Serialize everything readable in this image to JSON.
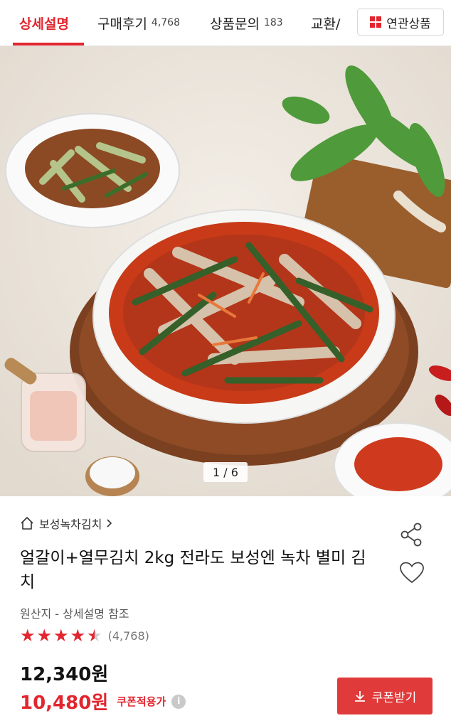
{
  "tabs": [
    {
      "label": "상세설명",
      "count": ""
    },
    {
      "label": "구매후기",
      "count": "4,768"
    },
    {
      "label": "상품문의",
      "count": "183"
    },
    {
      "label": "교환/",
      "count": ""
    }
  ],
  "related_label": "연관상품",
  "image_counter": "1 / 6",
  "store": "보성녹차김치",
  "product_title": "얼갈이+열무김치 2kg 전라도 보성엔 녹차 별미 김치",
  "origin": "원산지 - 상세설명 참조",
  "rating": {
    "stars": 4.5,
    "count": "(4,768)"
  },
  "price": "12,340원",
  "sale_price": "10,480원",
  "coupon_note": "쿠폰적용가",
  "coupon_button": "쿠폰받기",
  "colors": {
    "accent": "#e2262f",
    "button": "#e03a3a"
  }
}
